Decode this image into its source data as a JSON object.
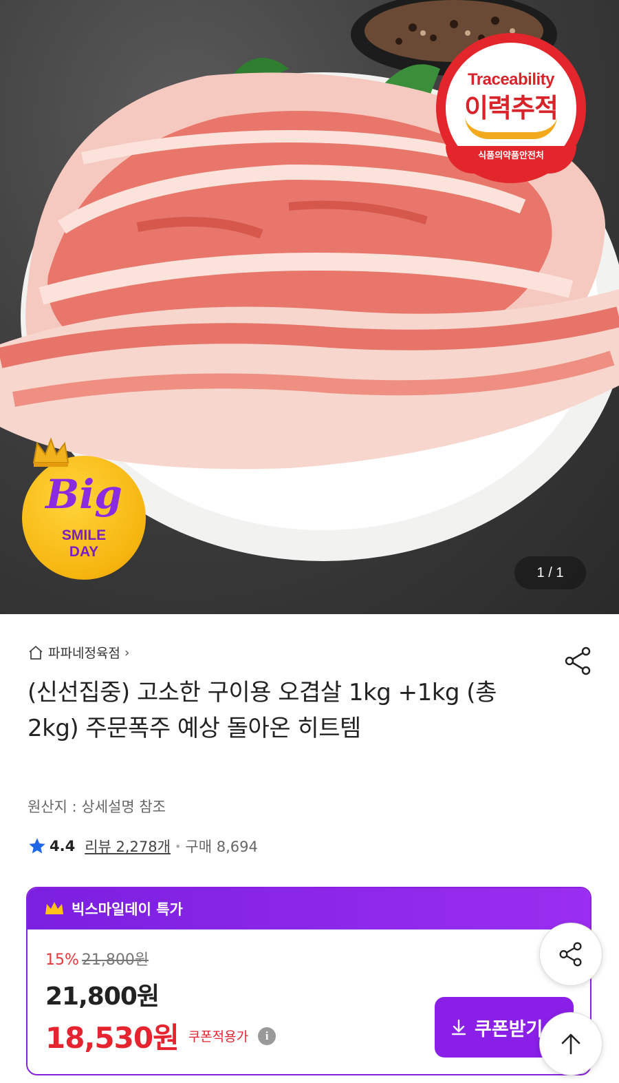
{
  "hero": {
    "pager": "1 / 1",
    "trace_badge": {
      "en": "Traceability",
      "ko": "이력추적",
      "sub": "식품의약품안전처"
    },
    "promo_badge": {
      "big": "Big",
      "smile": "SMILE",
      "day": "DAY"
    }
  },
  "product": {
    "store": "파파네정육점",
    "title": "(신선집중) 고소한 구이용 오겹살 1kg +1kg (총2kg) 주문폭주 예상 돌아온 히트템",
    "origin": "원산지 : 상세설명 참조",
    "rating": "4.4",
    "reviews": "리뷰 2,278개",
    "purchases": "구매 8,694"
  },
  "deal": {
    "title": "빅스마일데이 특가",
    "discount": "15%",
    "original_price": "21,800원",
    "price": "21,800원",
    "coupon_price": "18,530원",
    "coupon_label": "쿠폰적용가",
    "coupon_button": "쿠폰받기"
  },
  "colors": {
    "accent": "#8a1fe8",
    "sale_red": "#e6242f",
    "trace_red": "#e3262c",
    "star_blue": "#1e66e6"
  }
}
